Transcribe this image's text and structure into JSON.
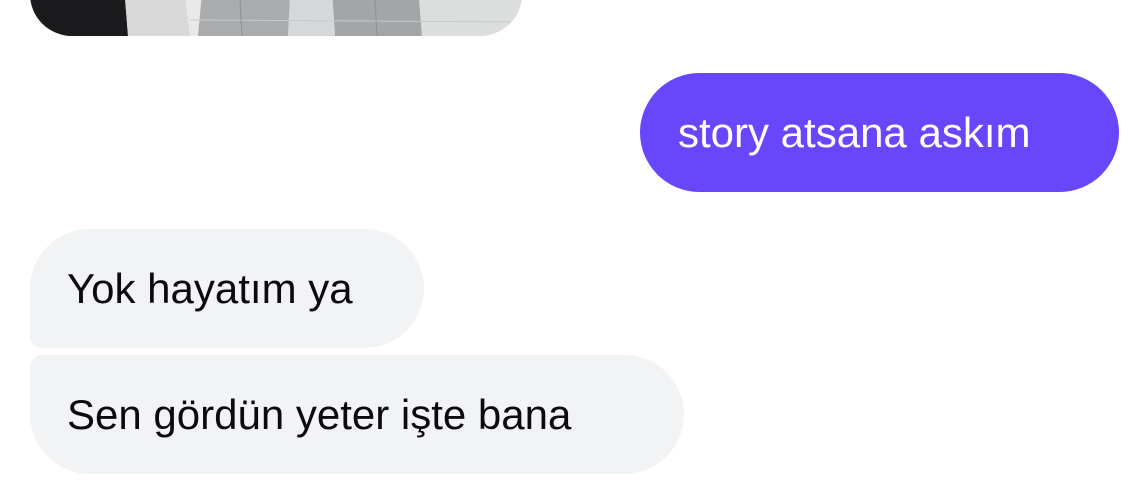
{
  "conversation": {
    "image_message": {
      "description_icon": "photo-icon"
    },
    "messages": [
      {
        "direction": "outgoing",
        "text": "story atsana askım"
      },
      {
        "direction": "incoming",
        "text": "Yok hayatım ya"
      },
      {
        "direction": "incoming",
        "text": "Sen gördün yeter işte bana"
      }
    ]
  },
  "colors": {
    "outgoing_bubble": "#6846fb",
    "incoming_bubble": "#f2f3f5",
    "background": "#ffffff"
  }
}
